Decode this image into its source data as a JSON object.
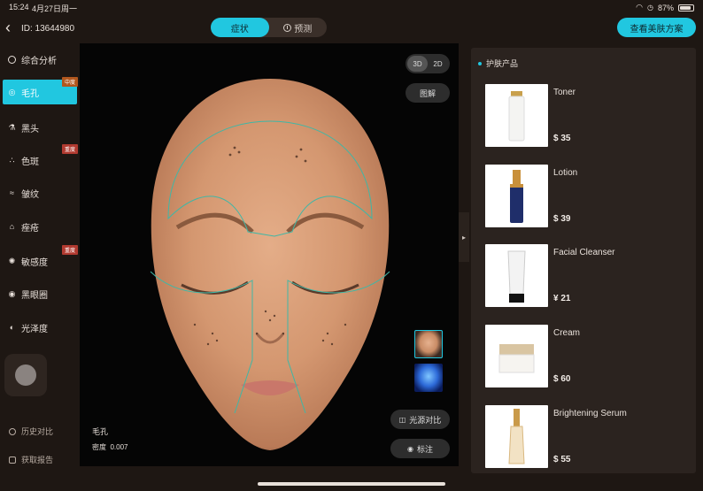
{
  "status_bar": {
    "time": "15:24",
    "date": "4月27日周一",
    "battery": "87%",
    "battery_level": 0.87
  },
  "header": {
    "user_id": "ID: 13644980",
    "tabs": [
      {
        "label": "症状",
        "active": true
      },
      {
        "label": "预测",
        "active": false
      }
    ],
    "view_plan_button": "查看美肤方案"
  },
  "sidebar": {
    "items": [
      {
        "label": "综合分析",
        "icon": "compass-icon"
      },
      {
        "label": "毛孔",
        "icon": "target-icon",
        "badge": "中度",
        "active": true
      },
      {
        "label": "黑头",
        "icon": "flask-icon"
      },
      {
        "label": "色斑",
        "icon": "dots-icon",
        "badge": "重度"
      },
      {
        "label": "皱纹",
        "icon": "wave-icon"
      },
      {
        "label": "痤疮",
        "icon": "house-icon"
      },
      {
        "label": "敏感度",
        "icon": "sun-icon",
        "badge": "重度"
      },
      {
        "label": "黑眼圈",
        "icon": "eye-icon"
      },
      {
        "label": "光泽度",
        "icon": "gloss-icon"
      }
    ],
    "history_compare": "历史对比",
    "get_report": "获取报告"
  },
  "viewer": {
    "mode_options": [
      "3D",
      "2D"
    ],
    "active_mode": "3D",
    "legend_button": "图解",
    "light_compare_button": "光源对比",
    "annotate_button": "标注",
    "metric_title": "毛孔",
    "metric_label": "密度",
    "metric_value": "0.007"
  },
  "products": {
    "title": "护肤产品",
    "items": [
      {
        "name": "Toner",
        "price": "$ 35"
      },
      {
        "name": "Lotion",
        "price": "$ 39"
      },
      {
        "name": "Facial Cleanser",
        "price": "¥ 21"
      },
      {
        "name": "Cream",
        "price": "$ 60"
      },
      {
        "name": "Brightening Serum",
        "price": "$ 55"
      }
    ]
  },
  "colors": {
    "accent": "#21c7e0",
    "background": "#1e1713",
    "panel": "#2b231f",
    "badge_severe": "#b13a30",
    "badge_moderate": "#b2571e",
    "zone_line": "#3fb7a6"
  }
}
